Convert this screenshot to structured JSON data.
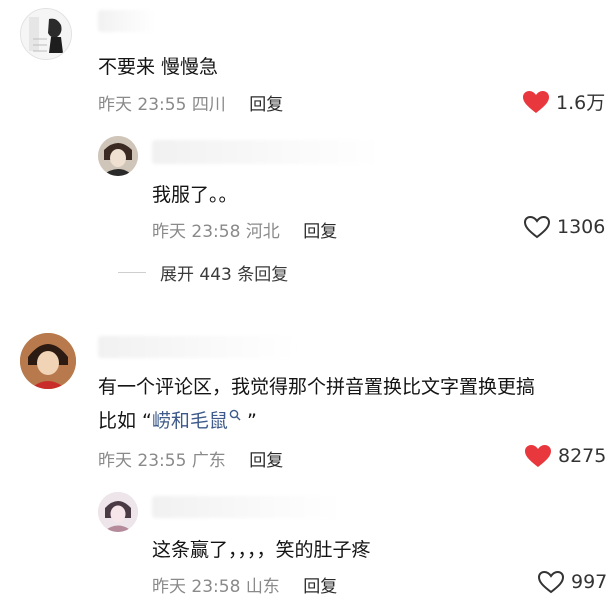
{
  "colors": {
    "liked": "#e8373d",
    "link": "#3d5a8a",
    "meta": "#8a8a8a"
  },
  "comments": [
    {
      "text": "不要来 慢慢急",
      "time": "昨天 23:55",
      "location": "四川",
      "reply_label": "回复",
      "likes": "1.6万",
      "liked": true,
      "replies": [
        {
          "text": "我服了。。",
          "time": "昨天 23:58",
          "location": "河北",
          "reply_label": "回复",
          "likes": "1306",
          "liked": false
        }
      ],
      "expand_label": "展开 443 条回复"
    },
    {
      "text_prefix": "有一个评论区，我觉得那个拼音置换比文字置换更搞",
      "text_line2_prefix": "比如 “",
      "text_link": "崂和毛鼠",
      "text_line2_suffix": " ”",
      "time": "昨天 23:55",
      "location": "广东",
      "reply_label": "回复",
      "likes": "8275",
      "liked": true,
      "replies": [
        {
          "text": "这条赢了，，，，笑的肚子疼",
          "time": "昨天 23:58",
          "location": "山东",
          "reply_label": "回复",
          "likes": "997",
          "liked": false
        }
      ]
    }
  ]
}
